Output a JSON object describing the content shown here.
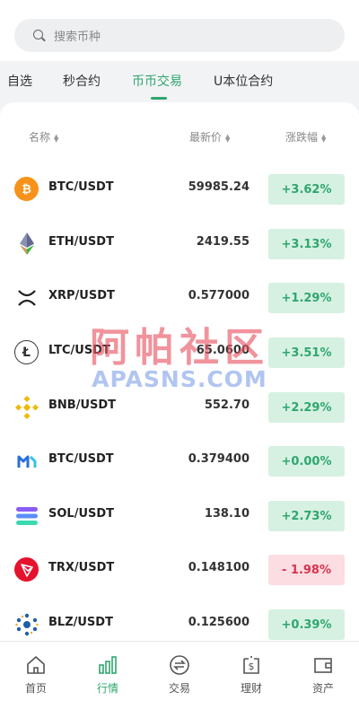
{
  "search": {
    "placeholder": "搜索币种"
  },
  "tabs": [
    {
      "label": "自选"
    },
    {
      "label": "秒合约"
    },
    {
      "label": "币币交易"
    },
    {
      "label": "U本位合约"
    }
  ],
  "active_tab": "币币交易",
  "columns": {
    "name": "名称",
    "price": "最新价",
    "change": "涨跌幅"
  },
  "rows": [
    {
      "icon": "bitcoin-icon",
      "pair": "BTC/USDT",
      "price": "59985.24",
      "change": "+3.62%",
      "direction": "up"
    },
    {
      "icon": "ethereum-icon",
      "pair": "ETH/USDT",
      "price": "2419.55",
      "change": "+3.13%",
      "direction": "up"
    },
    {
      "icon": "xrp-icon",
      "pair": "XRP/USDT",
      "price": "0.577000",
      "change": "+1.29%",
      "direction": "up"
    },
    {
      "icon": "litecoin-icon",
      "pair": "LTC/USDT",
      "price": "65.0600",
      "change": "+3.51%",
      "direction": "up"
    },
    {
      "icon": "bnb-icon",
      "pair": "BNB/USDT",
      "price": "552.70",
      "change": "+2.29%",
      "direction": "up"
    },
    {
      "icon": "polygon-icon",
      "pair": "BTC/USDT",
      "price": "0.379400",
      "change": "+0.00%",
      "direction": "up"
    },
    {
      "icon": "solana-icon",
      "pair": "SOL/USDT",
      "price": "138.10",
      "change": "+2.73%",
      "direction": "up"
    },
    {
      "icon": "tron-icon",
      "pair": "TRX/USDT",
      "price": "0.148100",
      "change": "- 1.98%",
      "direction": "down"
    },
    {
      "icon": "bluzelle-icon",
      "pair": "BLZ/USDT",
      "price": "0.125600",
      "change": "+0.39%",
      "direction": "up"
    }
  ],
  "watermark": {
    "cn": "阿帕社区",
    "en": "APASNS.COM"
  },
  "bottom_nav": [
    {
      "icon": "home-icon",
      "label": "首页"
    },
    {
      "icon": "market-icon",
      "label": "行情"
    },
    {
      "icon": "exchange-icon",
      "label": "交易"
    },
    {
      "icon": "finance-icon",
      "label": "理财"
    },
    {
      "icon": "wallet-icon",
      "label": "资产"
    }
  ],
  "active_nav": "行情",
  "colors": {
    "accent": "#2fa66f",
    "up_bg": "#d6f1e2",
    "down_bg": "#fbdde2",
    "down_text": "#d9344f"
  }
}
